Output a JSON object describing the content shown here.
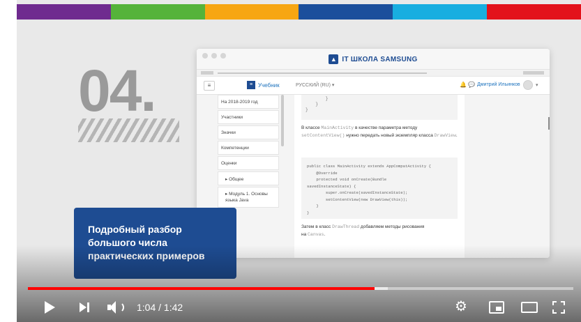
{
  "stripe_colors": [
    "#6f2b8f",
    "#55b33a",
    "#f7a612",
    "#1b4f9c",
    "#18aee0",
    "#e3121b"
  ],
  "slide": {
    "number": "04.",
    "caption_lines": [
      "Подробный разбор",
      "большого числа",
      "практических примеров"
    ]
  },
  "browser": {
    "brand": "IT ШКОЛА SAMSUNG",
    "moodle": {
      "menu_glyph": "≡",
      "logo_glyph": "≡",
      "site": "Учебник",
      "lang": "РУССКИЙ (RU) ▾",
      "user": "Дмитрий Ильинков",
      "caret": "▾"
    },
    "sidebar": [
      "На 2018-2019 год",
      "Участники",
      "Значки",
      "Компетенции",
      "Оценки",
      "▸ Общее",
      "▸ Модуль 1. Основы языка Java"
    ],
    "code_top": [
      "        }",
      "    }",
      "}"
    ],
    "para1": {
      "before": "В классе ",
      "code1": "MainActivity",
      "middle": " в качестве параметра методу ",
      "code2": "setContentView()",
      "after": " нужно передать новый экземпляр класса ",
      "code3": "DrawView",
      "end": "."
    },
    "code_main": "public class MainActivity extends AppCompatActivity {\n    @Override\n    protected void onCreate(Bundle\nsavedInstanceState) {\n        super.onCreate(savedInstanceState);\n        setContentView(new DrawView(this));\n    }\n}",
    "para2": {
      "before": "Затем в класс ",
      "code1": "DrawThread",
      "middle": " добавляем методы рисования",
      "after": " на ",
      "code2": "Canvas",
      "end": "."
    }
  },
  "player": {
    "time": "1:04 / 1:42",
    "played_fraction": 0.635,
    "loaded_fraction": 0.66,
    "gear_glyph": "⚙"
  }
}
